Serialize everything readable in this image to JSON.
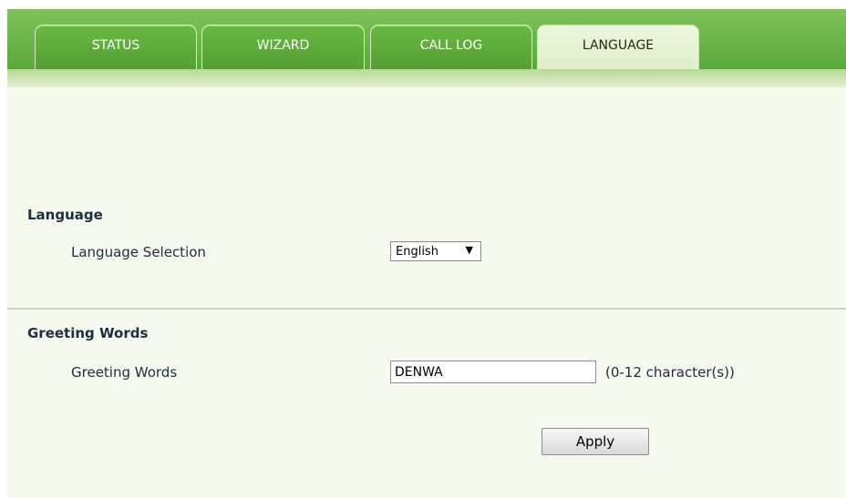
{
  "tabs": [
    {
      "label": "STATUS",
      "active": false
    },
    {
      "label": "WIZARD",
      "active": false
    },
    {
      "label": "CALL LOG",
      "active": false
    },
    {
      "label": "LANGUAGE",
      "active": true
    }
  ],
  "language_section": {
    "title": "Language",
    "selection_label": "Language Selection",
    "selected_value": "English"
  },
  "greeting_section": {
    "title": "Greeting Words",
    "field_label": "Greeting Words",
    "field_value": "DENWA",
    "hint": "(0-12 character(s))"
  },
  "apply_label": "Apply",
  "colors": {
    "header_green": "#5aa83a",
    "active_tab": "#e0efcb",
    "page_background": "#f5f9ee",
    "label_text": "#1d2e3e"
  },
  "icons": {
    "select_arrow": "caret-down-icon"
  }
}
